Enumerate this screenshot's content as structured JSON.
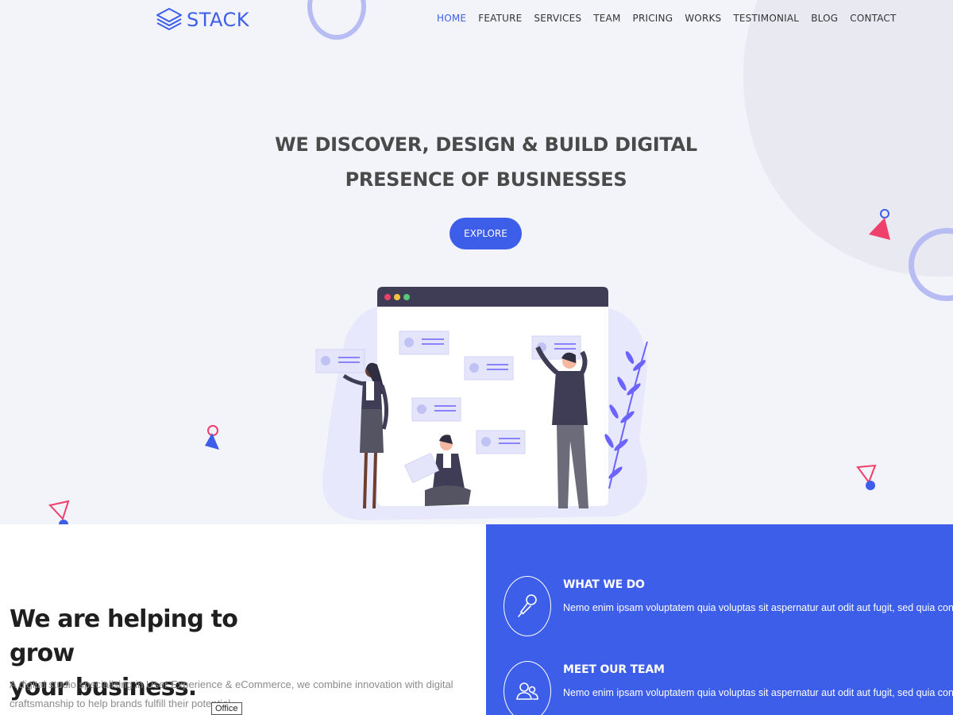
{
  "brand": {
    "name": "STACK",
    "logo_icon": "stacked-layers-icon"
  },
  "nav": {
    "items": [
      {
        "label": "HOME",
        "active": true
      },
      {
        "label": "FEATURE"
      },
      {
        "label": "SERVICES"
      },
      {
        "label": "TEAM"
      },
      {
        "label": "PRICING"
      },
      {
        "label": "WORKS"
      },
      {
        "label": "TESTIMONIAL"
      },
      {
        "label": "BLOG"
      },
      {
        "label": "CONTACT"
      }
    ]
  },
  "hero": {
    "title_line1": "WE DISCOVER, DESIGN & BUILD DIGITAL",
    "title_line2": "PRESENCE OF BUSINESSES",
    "cta_label": "EXPLORE"
  },
  "about": {
    "heading_line1": "We are helping to grow",
    "heading_line2": "your business.",
    "text": "A digital studio specialising in User Experience & eCommerce, we combine innovation with digital craftsmanship to help brands fulfill their potential.",
    "tooltip": "Office"
  },
  "features": [
    {
      "title": "WHAT WE DO",
      "description": "Nemo enim ipsam voluptatem quia voluptas sit aspernatur aut odit aut fugit, sed quia con- sequuntur",
      "icon": "microphone-icon"
    },
    {
      "title": "MEET OUR TEAM",
      "description": "Nemo enim ipsam voluptatem quia voluptas sit aspernatur aut odit aut fugit, sed quia con- sequuntur",
      "icon": "team-icon"
    }
  ],
  "colors": {
    "accent": "#3d5ee8",
    "hero_bg": "#f3f4f9",
    "pink": "#ef3f6b",
    "text_dark": "#4a4a4a"
  }
}
